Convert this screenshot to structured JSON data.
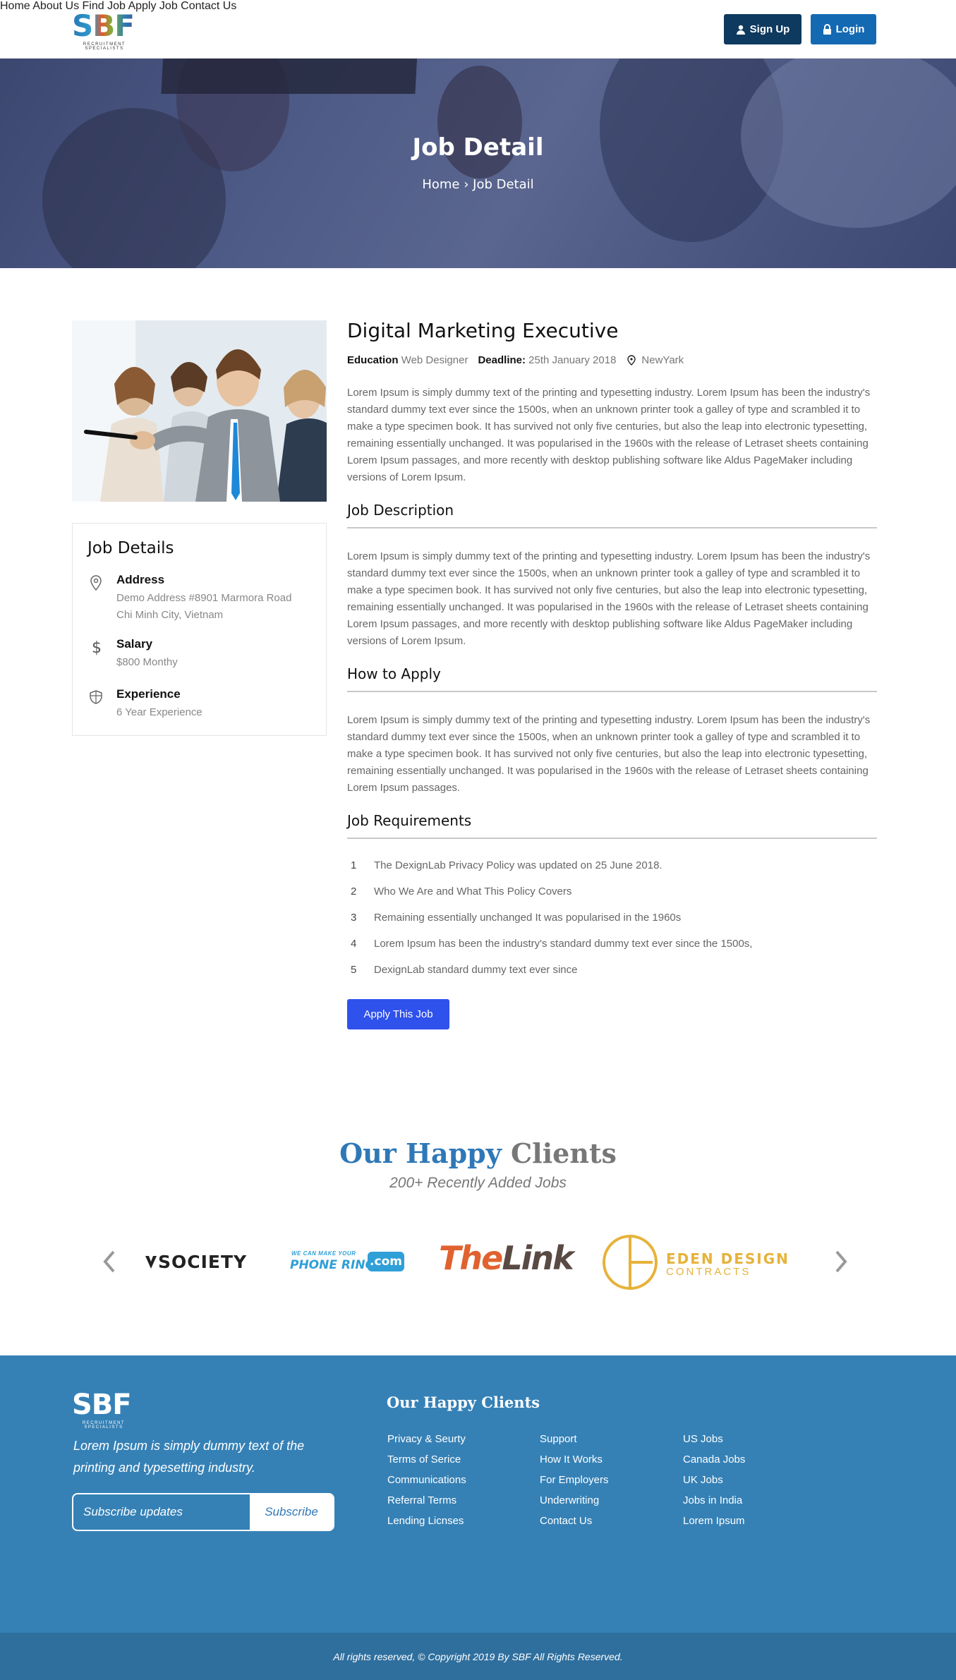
{
  "header": {
    "logo_text": "SBF",
    "logo_sub": "RECRUITMENT SPECIALISTS",
    "nav": [
      "Home",
      "About Us",
      "Find Job",
      "Apply Job",
      "Contact Us"
    ],
    "signup_label": "Sign Up",
    "login_label": "Login"
  },
  "hero": {
    "title": "Job Detail",
    "breadcrumb_home": "Home",
    "breadcrumb_sep": "›",
    "breadcrumb_current": "Job Detail"
  },
  "job_details": {
    "title": "Job Details",
    "address_label": "Address",
    "address_line1": "Demo Address #8901 Marmora Road",
    "address_line2": "Chi Minh City, Vietnam",
    "salary_label": "Salary",
    "salary_value": "$800 Monthy",
    "experience_label": "Experience",
    "experience_value": "6 Year Experience"
  },
  "job": {
    "title": "Digital Marketing Executive",
    "education_label": "Education",
    "education_value": "Web Designer",
    "deadline_label": "Deadline:",
    "deadline_value": "25th January 2018",
    "location": "NewYark",
    "intro": "Lorem Ipsum is simply dummy text of the printing and typesetting industry. Lorem Ipsum has been the industry's standard dummy text ever since the 1500s, when an unknown printer took a galley of type and scrambled it to make a type specimen book. It has survived not only five centuries, but also the leap into electronic typesetting, remaining essentially unchanged. It was popularised in the 1960s with the release of Letraset sheets containing Lorem Ipsum passages, and more recently with desktop publishing software like Aldus PageMaker including versions of Lorem Ipsum.",
    "description_title": "Job Description",
    "description": "Lorem Ipsum is simply dummy text of the printing and typesetting industry. Lorem Ipsum has been the industry's standard dummy text ever since the 1500s, when an unknown printer took a galley of type and scrambled it to make a type specimen book. It has survived not only five centuries, but also the leap into electronic typesetting, remaining essentially unchanged. It was popularised in the 1960s with the release of Letraset sheets containing Lorem Ipsum passages, and more recently with desktop publishing software like Aldus PageMaker including versions of Lorem Ipsum.",
    "apply_title": "How to Apply",
    "apply_text": "Lorem Ipsum is simply dummy text of the printing and typesetting industry. Lorem Ipsum has been the industry's standard dummy text ever since the 1500s, when an unknown printer took a galley of type and scrambled it to make a type specimen book. It has survived not only five centuries, but also the leap into electronic typesetting, remaining essentially unchanged. It was popularised in the 1960s with the release of Letraset sheets containing Lorem Ipsum passages.",
    "requirements_title": "Job Requirements",
    "requirements": [
      {
        "num": "1",
        "text": "The DexignLab Privacy Policy was updated on 25 June 2018."
      },
      {
        "num": "2",
        "text": "Who We Are and What This Policy Covers"
      },
      {
        "num": "3",
        "text": "Remaining essentially unchanged It was popularised in the 1960s"
      },
      {
        "num": "4",
        "text": "Lorem Ipsum has been the industry's standard dummy text ever since the 1500s,"
      },
      {
        "num": "5",
        "text": "DexignLab standard dummy text ever since"
      }
    ],
    "apply_button": "Apply This Job"
  },
  "clients": {
    "title_part1": "Our Happy",
    "title_part2": "Clients",
    "subtitle": "200+ Recently Added Jobs",
    "logos": {
      "society": "SOCIETY",
      "phonering_top": "WE CAN MAKE YOUR",
      "phonering_main": "PHONE RING",
      "phonering_com": ".com",
      "thelink_the": "The",
      "thelink_link": "Link",
      "eden_main": "EDEN DESIGN",
      "eden_sub": "CONTRACTS"
    }
  },
  "footer": {
    "logo_text": "SBF",
    "logo_sub": "RECRUITMENT SPECIALISTS",
    "tagline": "Lorem Ipsum is simply dummy text of the printing and typesetting industry.",
    "subscribe_placeholder": "Subscribe updates",
    "subscribe_button": "Subscribe",
    "heading": "Our Happy Clients",
    "col1": [
      "Privacy & Seurty",
      "Terms of Serice",
      "Communications",
      "Referral Terms",
      "Lending Licnses"
    ],
    "col2": [
      "Support",
      "How It Works",
      "For Employers",
      "Underwriting",
      "Contact Us"
    ],
    "col3": [
      "US Jobs",
      "Canada Jobs",
      "UK Jobs",
      "Jobs in India",
      "Lorem Ipsum"
    ],
    "copyright": "All rights reserved, © Copyright 2019 By  SBF All Rights Reserved."
  },
  "colors": {
    "primary_dark": "#0e3a5f",
    "primary": "#1469b3",
    "apply_blue": "#2f51ec",
    "footer_blue": "#3581b6",
    "footer_bottom": "#2f6f9e",
    "eden_gold": "#e6b23a",
    "thelink_orange": "#e0622f"
  }
}
